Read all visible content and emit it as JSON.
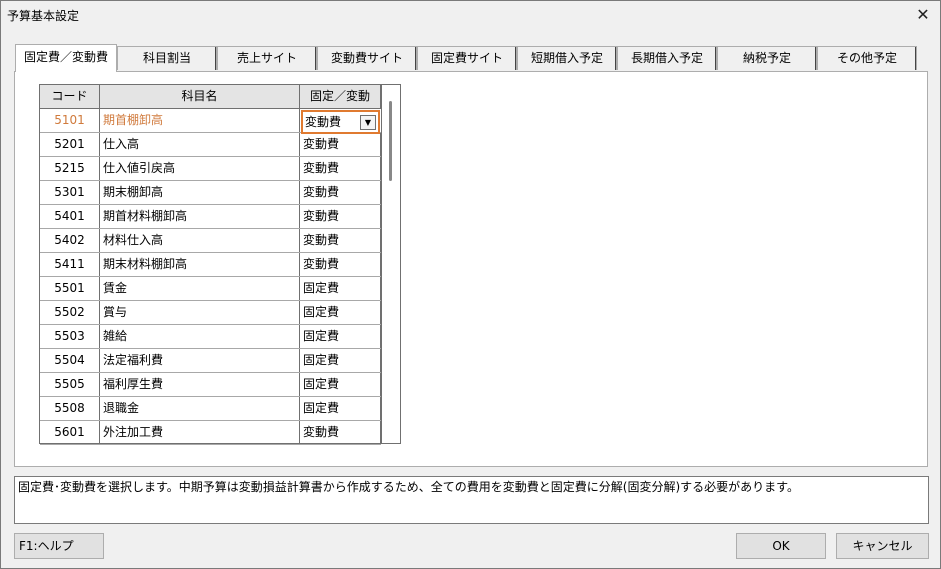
{
  "window": {
    "title": "予算基本設定",
    "close_glyph": "✕"
  },
  "tabs": [
    {
      "label": "固定費／変動費",
      "active": true
    },
    {
      "label": "科目割当",
      "active": false
    },
    {
      "label": "売上サイト",
      "active": false
    },
    {
      "label": "変動費サイト",
      "active": false
    },
    {
      "label": "固定費サイト",
      "active": false
    },
    {
      "label": "短期借入予定",
      "active": false
    },
    {
      "label": "長期借入予定",
      "active": false
    },
    {
      "label": "納税予定",
      "active": false
    },
    {
      "label": "その他予定",
      "active": false
    }
  ],
  "grid": {
    "headers": {
      "code": "コード",
      "name": "科目名",
      "type": "固定／変動"
    },
    "selected_row": 0,
    "combo_value": "変動費",
    "combo_arrow": "▼",
    "rows": [
      {
        "code": "5101",
        "name": "期首棚卸高",
        "type": "変動費"
      },
      {
        "code": "5201",
        "name": "仕入高",
        "type": "変動費"
      },
      {
        "code": "5215",
        "name": "仕入値引戻高",
        "type": "変動費"
      },
      {
        "code": "5301",
        "name": "期末棚卸高",
        "type": "変動費"
      },
      {
        "code": "5401",
        "name": "期首材料棚卸高",
        "type": "変動費"
      },
      {
        "code": "5402",
        "name": "材料仕入高",
        "type": "変動費"
      },
      {
        "code": "5411",
        "name": "期末材料棚卸高",
        "type": "変動費"
      },
      {
        "code": "5501",
        "name": "賃金",
        "type": "固定費"
      },
      {
        "code": "5502",
        "name": "賞与",
        "type": "固定費"
      },
      {
        "code": "5503",
        "name": "雑給",
        "type": "固定費"
      },
      {
        "code": "5504",
        "name": "法定福利費",
        "type": "固定費"
      },
      {
        "code": "5505",
        "name": "福利厚生費",
        "type": "固定費"
      },
      {
        "code": "5508",
        "name": "退職金",
        "type": "固定費"
      },
      {
        "code": "5601",
        "name": "外注加工費",
        "type": "変動費"
      }
    ]
  },
  "message": "固定費･変動費を選択します。中期予算は変動損益計算書から作成するため、全ての費用を変動費と固定費に分解(固変分解)する必要があります。",
  "buttons": {
    "help": "F1:ヘルプ",
    "ok": "OK",
    "cancel": "キャンセル"
  },
  "colors": {
    "selected_text": "#d07a3c",
    "combo_border": "#e07a30"
  }
}
